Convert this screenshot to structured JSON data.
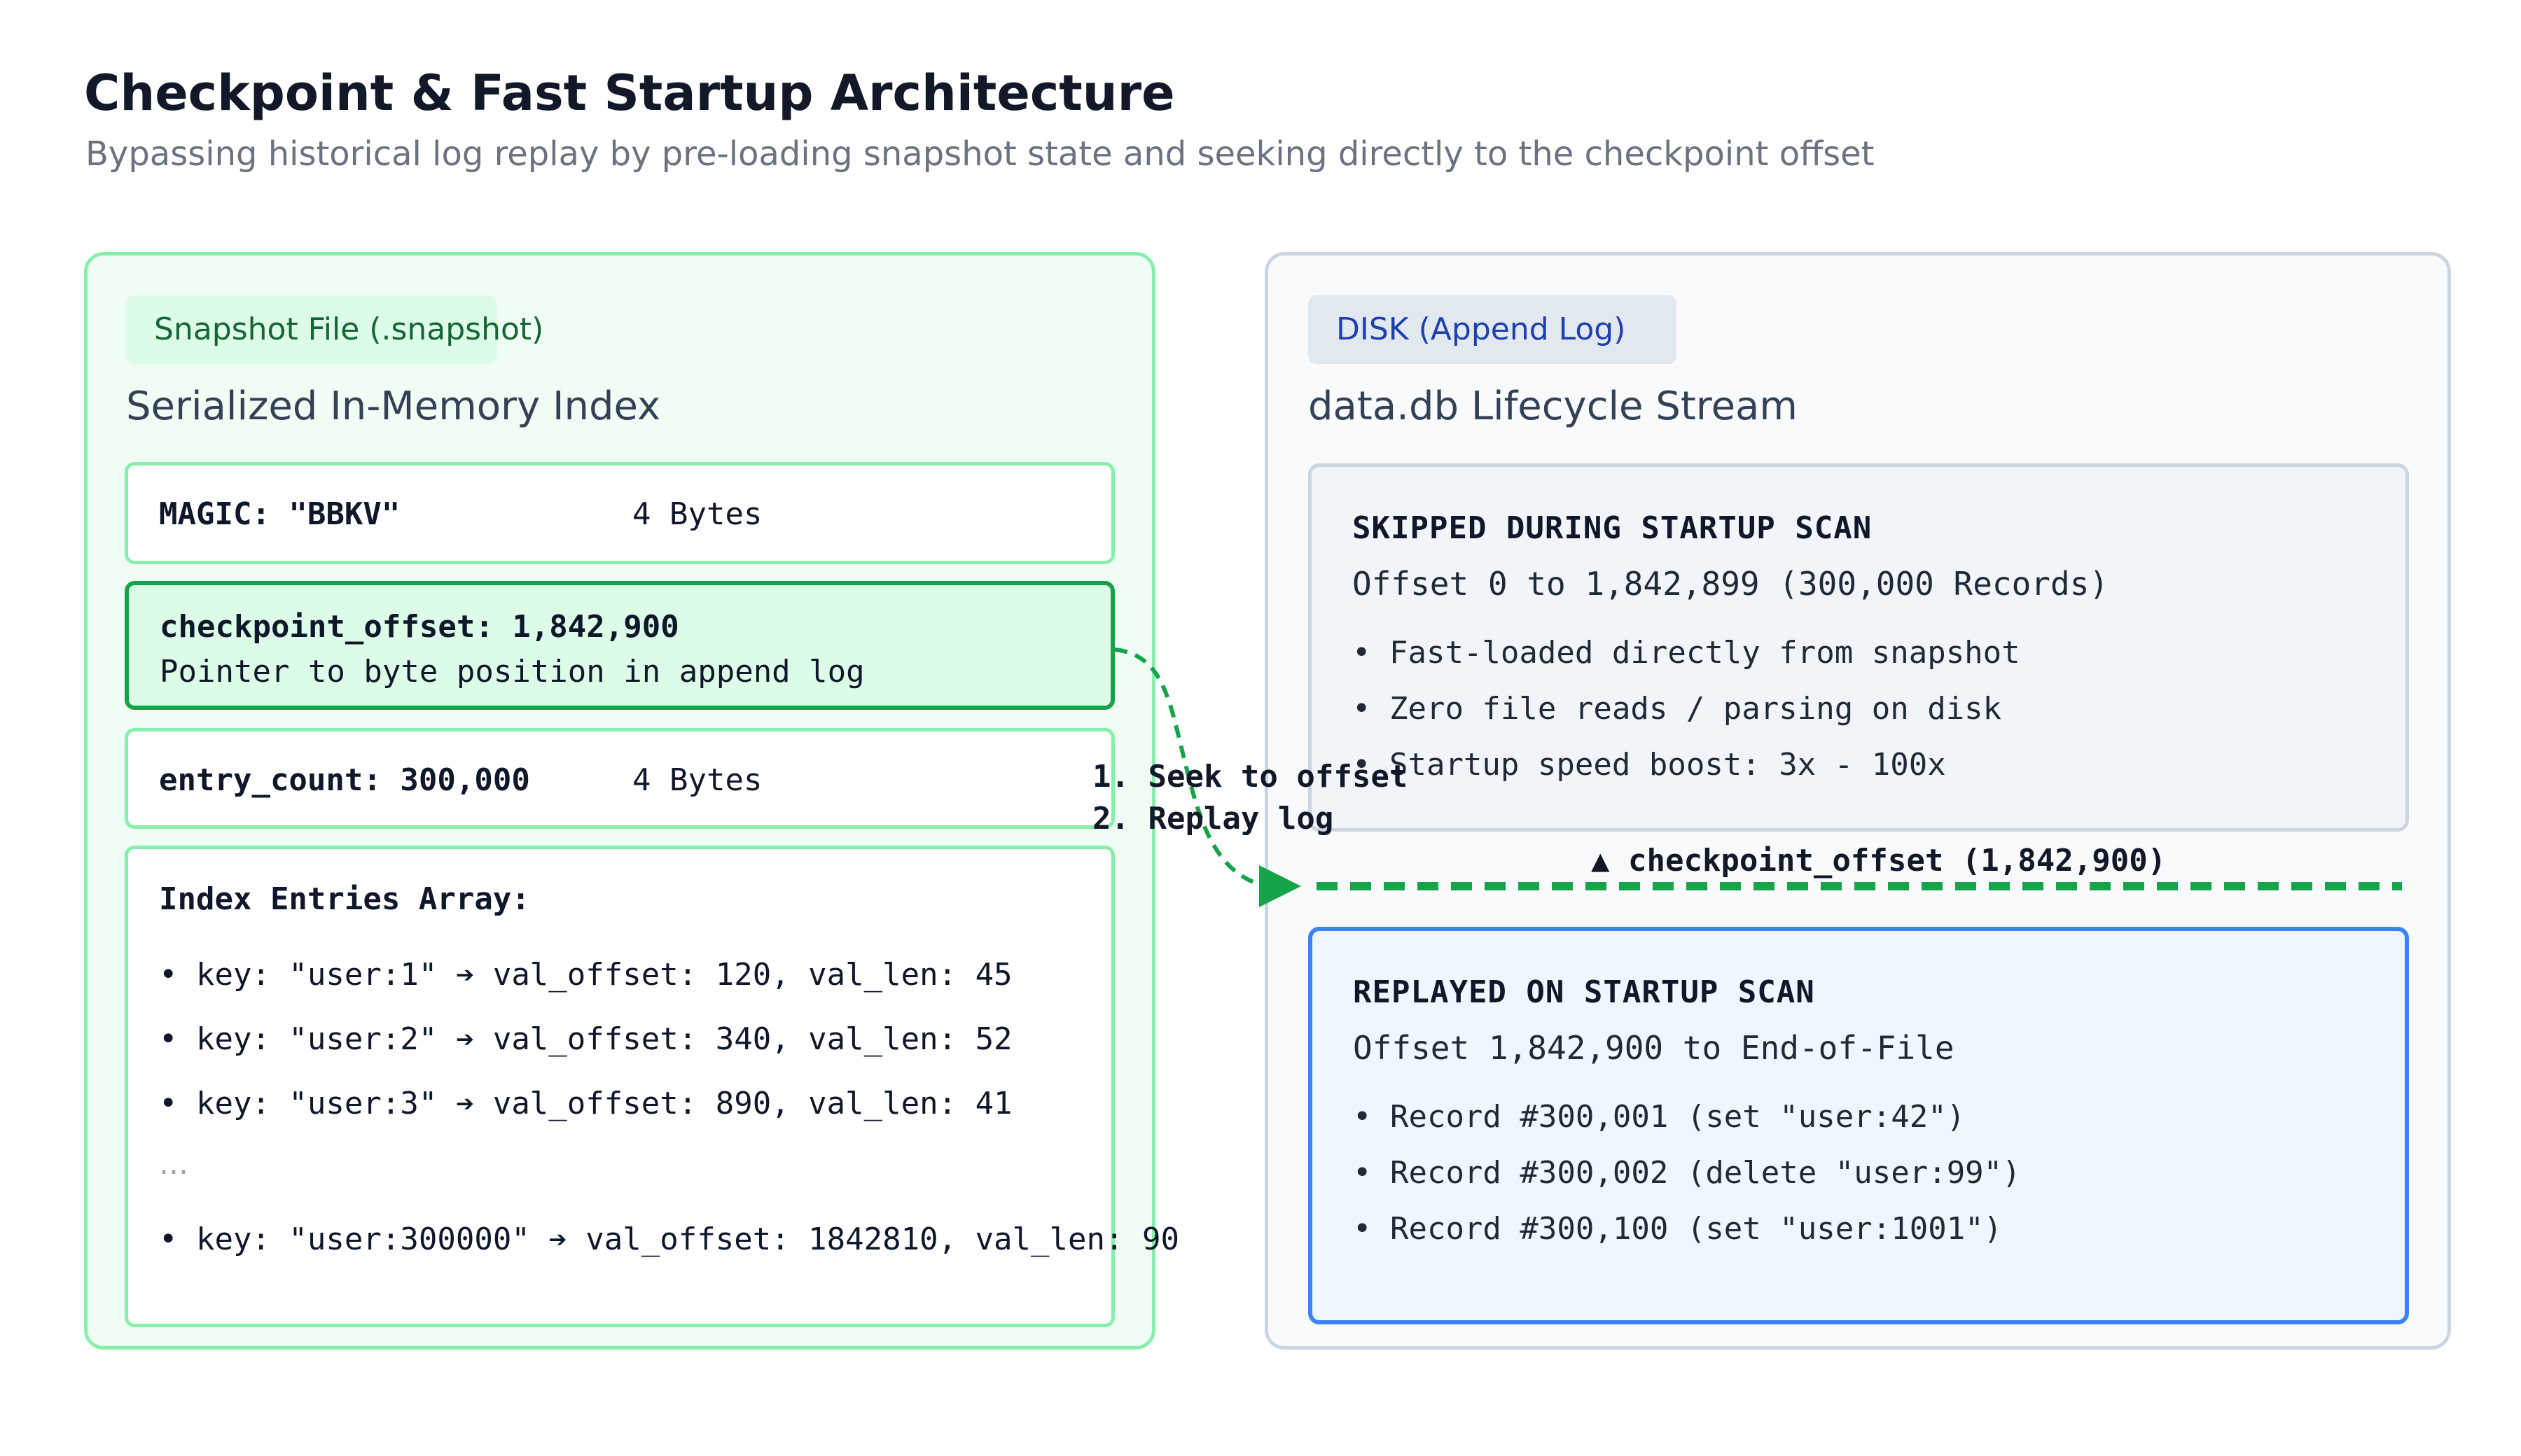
{
  "title": "Checkpoint & Fast Startup Architecture",
  "subtitle": "Bypassing historical log replay by pre-loading snapshot state and seeking directly to the checkpoint offset",
  "left_panel": {
    "tag": "Snapshot File (.snapshot)",
    "heading": "Serialized In-Memory Index",
    "magic": {
      "label": "MAGIC: \"BBKV\"",
      "size": "4 Bytes"
    },
    "checkpoint": {
      "label": "checkpoint_offset: 1,842,900",
      "description": "Pointer to byte position in append log"
    },
    "entry_count": {
      "label": "entry_count: 300,000",
      "size": "4 Bytes"
    },
    "index": {
      "heading": "Index Entries Array:",
      "entries": [
        "• key: \"user:1\" ➔ val_offset: 120, val_len: 45",
        "• key: \"user:2\" ➔ val_offset: 340, val_len: 52",
        "• key: \"user:3\" ➔ val_offset: 890, val_len: 41"
      ],
      "ellipsis": "...",
      "last_entry": "• key: \"user:300000\" ➔ val_offset: 1842810, val_len: 90"
    }
  },
  "right_panel": {
    "tag": "DISK (Append Log)",
    "heading": "data.db Lifecycle Stream",
    "skipped": {
      "heading": "SKIPPED DURING STARTUP SCAN",
      "range": "Offset 0 to 1,842,899 (300,000 Records)",
      "bullets": [
        "• Fast-loaded directly from snapshot",
        "• Zero file reads / parsing on disk",
        "• Startup speed boost: 3x - 100x"
      ]
    },
    "checkpoint_marker": "▲ checkpoint_offset (1,842,900)",
    "replayed": {
      "heading": "REPLAYED ON STARTUP SCAN",
      "range": "Offset 1,842,900 to End-of-File",
      "bullets": [
        "• Record #300,001 (set \"user:42\")",
        "• Record #300,002 (delete \"user:99\")",
        "• Record #300,100 (set \"user:1001\")"
      ]
    }
  },
  "connector": {
    "step1": "1. Seek to offset",
    "step2": "2. Replay log"
  },
  "colors": {
    "green_accent": "#16a34a",
    "green_light": "#86efac",
    "blue_accent": "#3b82f6",
    "slate_border": "#cbd5e1"
  }
}
